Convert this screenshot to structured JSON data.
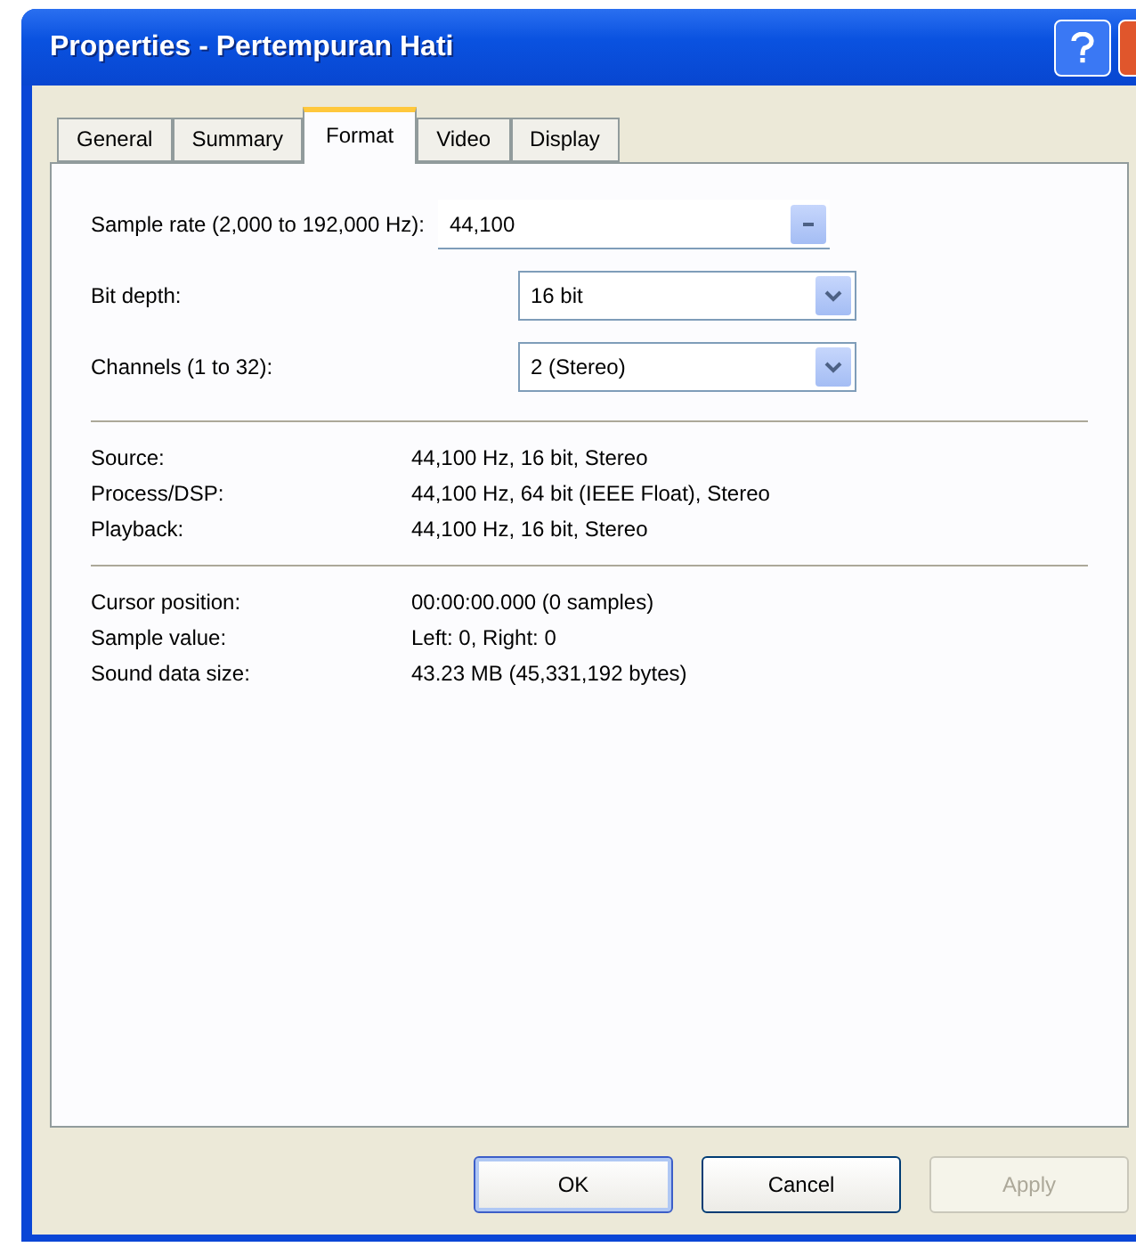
{
  "window": {
    "title": "Properties - Pertempuran Hati"
  },
  "tabs": [
    {
      "label": "General",
      "selected": false
    },
    {
      "label": "Summary",
      "selected": false
    },
    {
      "label": "Format",
      "selected": true
    },
    {
      "label": "Video",
      "selected": false
    },
    {
      "label": "Display",
      "selected": false
    }
  ],
  "settings": [
    {
      "kind": "editable",
      "label": "Sample rate (2,000 to 192,000 Hz):",
      "value": "44,100"
    },
    {
      "kind": "dropdown",
      "label": "Bit depth:",
      "value": "16 bit"
    },
    {
      "kind": "dropdown",
      "label": "Channels (1 to 32):",
      "value": "2 (Stereo)"
    }
  ],
  "info_groups": [
    [
      {
        "label": "Source:",
        "value": "44,100 Hz, 16 bit, Stereo"
      },
      {
        "label": "Process/DSP:",
        "value": "44,100 Hz, 64 bit (IEEE Float), Stereo"
      },
      {
        "label": "Playback:",
        "value": "44,100 Hz, 16 bit, Stereo"
      }
    ],
    [
      {
        "label": "Cursor position:",
        "value": "00:00:00.000 (0 samples)"
      },
      {
        "label": "Sample value:",
        "value": "Left: 0, Right: 0"
      },
      {
        "label": "Sound data size:",
        "value": "43.23 MB (45,331,192 bytes)"
      }
    ]
  ],
  "buttons": [
    {
      "label": "OK",
      "default": true,
      "disabled": false
    },
    {
      "label": "Cancel",
      "default": false,
      "disabled": false
    },
    {
      "label": "Apply",
      "default": false,
      "disabled": true
    }
  ]
}
